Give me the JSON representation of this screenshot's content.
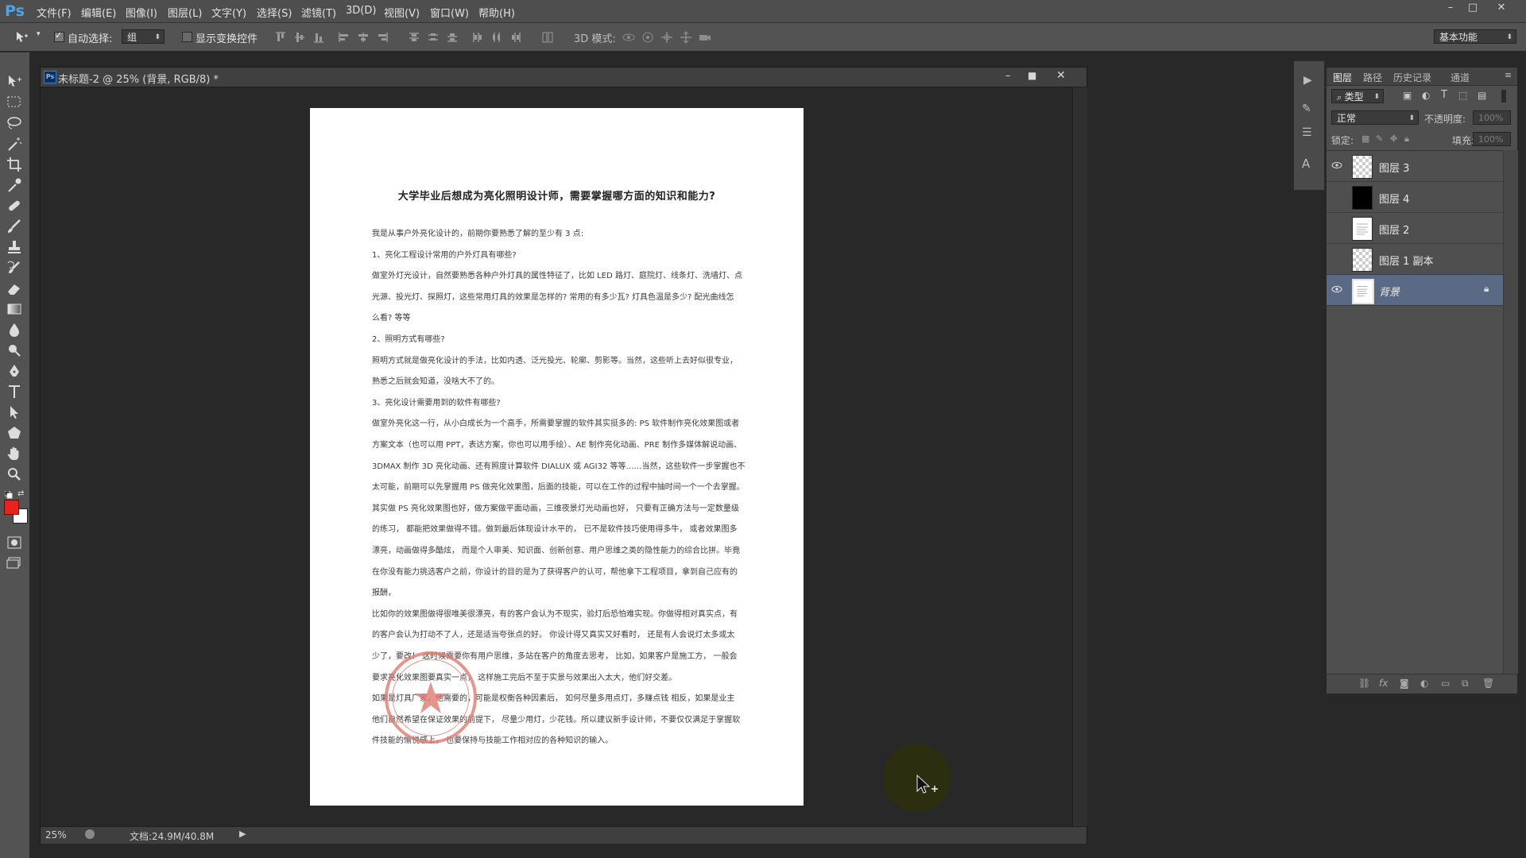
{
  "app": {
    "logo": "Ps",
    "menu": [
      "文件(F)",
      "编辑(E)",
      "图像(I)",
      "图层(L)",
      "文字(Y)",
      "选择(S)",
      "滤镜(T)",
      "3D(D)",
      "视图(V)",
      "窗口(W)",
      "帮助(H)"
    ]
  },
  "options_bar": {
    "auto_select_label": "自动选择:",
    "auto_select_checked": true,
    "auto_select_value": "组",
    "show_transform_label": "显示变换控件",
    "show_transform_checked": false,
    "mode_3d_label": "3D 模式:",
    "workspace": "基本功能"
  },
  "document": {
    "title": "未标题-2 @ 25% (背景, RGB/8) *",
    "zoom": "25%",
    "doc_size": "文档:24.9M/40.8M",
    "page": {
      "title": "大学毕业后想成为亮化照明设计师，需要掌握哪方面的知识和能力?",
      "lines": [
        "我是从事户外亮化设计的，前期你要熟悉了解的至少有 3 点:",
        "1、亮化工程设计常用的户外灯具有哪些?",
        "做室外灯光设计，自然要熟悉各种户外灯具的属性特征了，比如 LED 路灯、庭院灯、线条灯、洗墙灯、点",
        "光源、投光灯、探照灯，这些常用灯具的效果是怎样的? 常用的有多少瓦? 灯具色温是多少? 配光曲线怎",
        "么看? 等等",
        "2、照明方式有哪些?",
        "照明方式就是做亮化设计的手法，比如内透、泛光投光、轮廓、剪影等。当然，这些听上去好似很专业，",
        "熟悉之后就会知道，没啥大不了的。",
        "3、亮化设计需要用到的软件有哪些?",
        "做室外亮化这一行，从小白成长为一个高手，所需要掌握的软件其实挺多的: PS 软件制作亮化效果图或者",
        "方案文本（也可以用 PPT，表达方案，你也可以用手绘）、AE 制作亮化动画、PRE 制作多媒体解说动画、",
        "3DMAX 制作 3D 亮化动画、还有照度计算软件 DIALUX 或 AGI32 等等……当然，这些软件一步掌握也不",
        "太可能，前期可以先掌握用 PS 做亮化效果图，后面的技能，可以在工作的过程中抽时间一个一个去掌握。",
        "其实做 PS 亮化效果图也好，做方案做平面动画，三维夜景灯光动画也好， 只要有正确方法与一定数量级",
        "的练习， 都能把效果做得不错。做到最后体现设计水平的， 已不是软件技巧使用得多牛， 或者效果图多",
        "漂亮，动画做得多酷炫， 而是个人审美、知识面、创新创意、用户思维之类的隐性能力的综合比拼。毕竟",
        "在你没有能力挑选客户之前，你设计的目的是为了获得客户的认可，帮他拿下工程项目，拿到自己应有的",
        "报酬，",
        "比如你的效果图做得很唯美很漂亮，有的客户会认为不现实，验灯后恐怕难实现。你做得相对真实点，有",
        "的客户会认为打动不了人，还是适当夸张点的好。 你设计得又真实又好看时， 还是有人会说灯太多或太",
        "少了，要改！ 这时候需要你有用户思维，多站在客户的角度去思考， 比如，如果客户是施工方， 一般会",
        "要求亮化效果图要真实一点， 这样施工完后不至于实景与效果出入太大，他们好交差。",
        "如果是灯具厂家，他需要的，可能是权衡各种因素后， 如何尽量多用点灯，多赚点钱 相反，如果是业主",
        "他们自然希望在保证效果的前提下， 尽量少用灯，少花钱。所以建议新手设计师，不要仅仅满足于掌握软",
        "件技能的愉悦感上， 也要保持与技能工作相对应的各种知识的输入。"
      ]
    }
  },
  "layers_panel": {
    "tabs": [
      "图层",
      "路径",
      "历史记录",
      "通道"
    ],
    "filter_kind": "类型",
    "blend_mode": "正常",
    "opacity_label": "不透明度:",
    "opacity_value": "100%",
    "lock_label": "锁定:",
    "fill_label": "填充:",
    "fill_value": "100%",
    "layers": [
      {
        "name": "图层 3",
        "visible": true,
        "thumb": "checker"
      },
      {
        "name": "图层 4",
        "visible": false,
        "thumb": "black"
      },
      {
        "name": "图层 2",
        "visible": false,
        "thumb": "doc"
      },
      {
        "name": "图层 1 副本",
        "visible": false,
        "thumb": "checker"
      },
      {
        "name": "背景",
        "visible": true,
        "thumb": "doc",
        "locked": true,
        "selected": true
      }
    ]
  },
  "colors": {
    "foreground": "#e8231f",
    "background": "#ffffff",
    "selection": "#5a6a85",
    "stamp": "#e07a70"
  }
}
